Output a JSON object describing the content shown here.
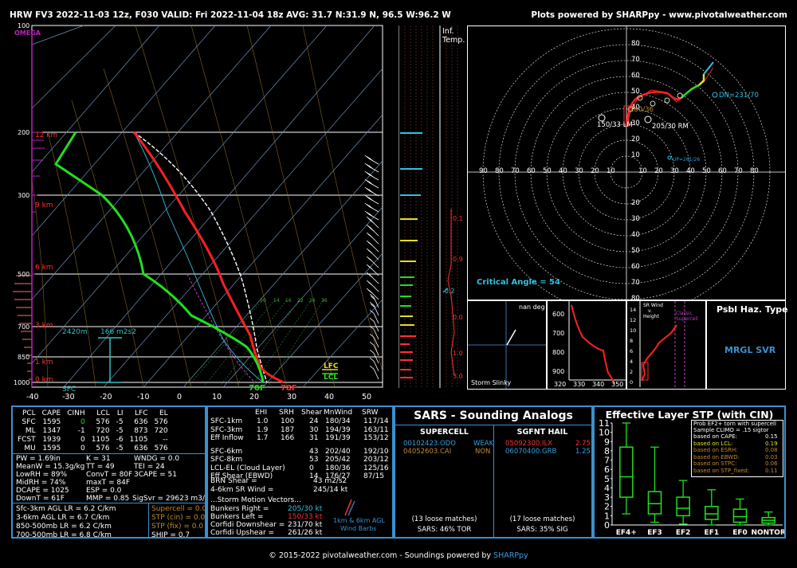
{
  "header": {
    "title": "HRW FV3 2022-11-03 12z, F030  VALID: Fri 2022-11-04 18z  AVG: 31.7 N:31.9 N, 96.5 W:96.2 W",
    "credit": "Plots powered by SHARPpy - www.pivotalweather.com"
  },
  "skewt": {
    "pressure_labels": [
      "100",
      "200",
      "300",
      "500",
      "700",
      "850",
      "1000"
    ],
    "height_labels": [
      "12 km",
      "9 km",
      "6 km",
      "3 km",
      "1 km",
      "0 km"
    ],
    "temp_ticks": [
      "-40",
      "-30",
      "-20",
      "-10",
      "0",
      "10",
      "20",
      "30",
      "40",
      "50"
    ],
    "omega_label": "OMEGA",
    "hgt_label": "2420m",
    "srh_label": "166 m2s2",
    "sfc_label": "SFC",
    "lfc_label": "LFC",
    "lcl_label": "LCL",
    "tsfc_label": "78F",
    "tdsfc_label": "70F",
    "mix_labels": [
      "10",
      "14",
      "16",
      "22",
      "26",
      "36",
      "44"
    ]
  },
  "inftemp": {
    "label1": "Inf.",
    "label2": "Temp.",
    "values": [
      "0.1",
      "0.9",
      "-0.2",
      "0.0",
      "1.0",
      "3.0"
    ]
  },
  "hodograph": {
    "rings": [
      "80",
      "70",
      "60",
      "50",
      "40",
      "30",
      "20",
      "10",
      "20",
      "30",
      "40",
      "50",
      "60",
      "70",
      "80"
    ],
    "x_ticks": [
      "90",
      "80",
      "70",
      "60",
      "50",
      "40",
      "30",
      "20",
      "10",
      "10",
      "20",
      "30",
      "40",
      "50",
      "60",
      "70",
      "80"
    ],
    "lm_label": "150/33 LM",
    "rm_label": "205/30 RM",
    "dn_label": "DN=231/70",
    "mean_label": "180/36",
    "up_label": "UP=261/26",
    "critical": "Critical Angle = 54"
  },
  "slinky": {
    "title": "nan deg",
    "label": "Storm Slinky"
  },
  "thetae": {
    "y_ticks": [
      "600",
      "700",
      "800",
      "900"
    ],
    "x_ticks": [
      "320",
      "330",
      "340",
      "350"
    ]
  },
  "srwind": {
    "title1": "SR Wind",
    "title2": "v.",
    "title3": "Height",
    "ticks": [
      "14",
      "12",
      "10",
      "8",
      "6",
      "4",
      "2",
      "0"
    ],
    "classic": "Classic Supercell"
  },
  "haz": {
    "title": "Psbl Haz. Type",
    "value": "MRGL SVR"
  },
  "parcels": {
    "headers": [
      "PCL",
      "CAPE",
      "CINH",
      "LCL",
      "LI",
      "LFC",
      "EL"
    ],
    "rows": [
      [
        "SFC",
        "1595",
        "0",
        "576",
        "-5",
        "636",
        "576"
      ],
      [
        "ML",
        "1347",
        "-1",
        "720",
        "-5",
        "873",
        "720"
      ],
      [
        "FCST",
        "1939",
        "0",
        "1105",
        "-6",
        "1105",
        "--"
      ],
      [
        "MU",
        "1595",
        "0",
        "576",
        "-5",
        "636",
        "576"
      ]
    ],
    "misc": [
      [
        "PW = 1.69in",
        "K = 31",
        "WNDG = 0.0"
      ],
      [
        "MeanW = 15.3g/kg",
        "TT = 49",
        "TEI = 24"
      ],
      [
        "LowRH = 89%",
        "ConvT = 80F",
        "3CAPE = 51"
      ],
      [
        "MidRH = 74%",
        "maxT = 84F",
        ""
      ],
      [
        "DCAPE = 1025",
        "ESP = 0.0",
        ""
      ],
      [
        "DownT = 61F",
        "MMP = 0.85",
        "SigSvr = 29623 m3/s3"
      ]
    ],
    "lapse": [
      "Sfc-3km AGL LR = 6.2 C/km",
      "3-6km AGL LR = 6.7 C/km",
      "850-500mb LR = 6.2 C/km",
      "700-500mb LR = 6.8 C/km"
    ],
    "sev": [
      "Supercell = 0.0",
      "STP (cin) = 0.0",
      "STP (fix) = 0.0",
      "SHIP = 0.7"
    ]
  },
  "kinematics": {
    "headers": [
      "EHI",
      "SRH",
      "Shear",
      "MnWind",
      "SRW"
    ],
    "rows": [
      [
        "SFC-1km",
        "1.0",
        "100",
        "24",
        "180/34",
        "117/14"
      ],
      [
        "SFC-3km",
        "1.9",
        "187",
        "30",
        "194/39",
        "163/11"
      ],
      [
        "Eff Inflow",
        "1.7",
        "166",
        "31",
        "191/39",
        "153/12"
      ],
      [
        "SFC-6km",
        "",
        "",
        "43",
        "202/40",
        "192/10"
      ],
      [
        "SFC-8km",
        "",
        "",
        "53",
        "205/42",
        "203/12"
      ],
      [
        "LCL-EL (Cloud Layer)",
        "",
        "",
        "0",
        "180/36",
        "125/16"
      ],
      [
        "Eff Shear (EBWD)",
        "",
        "",
        "14",
        "176/27",
        "87/15"
      ]
    ],
    "brn_label": "BRN Shear =",
    "brn_value": "43 m2/s2",
    "sr_label": "4-6km SR Wind =",
    "sr_value": "245/14 kt",
    "storm_title": "...Storm Motion Vectors...",
    "motions": [
      [
        "Bunkers Right =",
        "205/30 kt"
      ],
      [
        "Bunkers Left =",
        "150/33 kt"
      ],
      [
        "Corfidi Downshear =",
        "231/70 kt"
      ],
      [
        "Corfidi Upshear =",
        "261/26 kt"
      ]
    ],
    "barb_label1": "1km & 6km AGL",
    "barb_label2": "Wind Barbs"
  },
  "sars": {
    "title": "SARS - Sounding Analogs",
    "supercell_title": "SUPERCELL",
    "hail_title": "SGFNT HAIL",
    "supercell": [
      [
        "00102423.ODO",
        "WEAK"
      ],
      [
        "04052603.CAI",
        "NON"
      ]
    ],
    "hail": [
      [
        "05092300.ILX",
        "2.75"
      ],
      [
        "06070400.GRB",
        "1.25"
      ]
    ],
    "supercell_matches": "(13 loose matches)",
    "hail_matches": "(17 loose matches)",
    "supercell_result": "SARS: 46% TOR",
    "hail_result": "SARS: 35% SIG"
  },
  "stp": {
    "title": "Effective Layer STP (with CIN)",
    "legend_title1": "Prob EF2+ torn with supercell",
    "legend_title2": "Sample CLIMO = .15 sigtor",
    "legend": [
      [
        "based on CAPE:",
        "0.15"
      ],
      [
        "based on LCL:",
        "0.19"
      ],
      [
        "based on ESRH:",
        "0.08"
      ],
      [
        "based on EBWD:",
        "0.03"
      ],
      [
        "based on STPC:",
        "0.06"
      ],
      [
        "based on STP_fixed:",
        "0.11"
      ]
    ]
  },
  "chart_data": {
    "type": "box",
    "title": "Effective Layer STP (with CIN)",
    "categories": [
      "EF4+",
      "EF3",
      "EF2",
      "EF1",
      "EF0",
      "NONTOR"
    ],
    "ylim": [
      0,
      11
    ],
    "boxes": [
      {
        "min": 1.2,
        "q1": 3.0,
        "median": 5.2,
        "q3": 8.4,
        "max": 11.0
      },
      {
        "min": 0.3,
        "q1": 1.2,
        "median": 2.3,
        "q3": 3.6,
        "max": 8.4
      },
      {
        "min": 0.1,
        "q1": 1.0,
        "median": 1.8,
        "q3": 3.0,
        "max": 4.8
      },
      {
        "min": 0.0,
        "q1": 0.6,
        "median": 1.2,
        "q3": 2.0,
        "max": 3.8
      },
      {
        "min": 0.0,
        "q1": 0.3,
        "median": 0.9,
        "q3": 1.7,
        "max": 2.8
      },
      {
        "min": 0.0,
        "q1": 0.2,
        "median": 0.5,
        "q3": 0.8,
        "max": 1.4
      }
    ],
    "y_ticks": [
      "0",
      "1",
      "2",
      "3",
      "4",
      "5",
      "6",
      "7",
      "8",
      "9",
      "10",
      "11"
    ]
  },
  "footer": {
    "text": "© 2015-2022 pivotalweather.com - Soundings powered by ",
    "link": "SHARPpy"
  },
  "colors": {
    "border": "#3a90d0",
    "temp": "#ff2020",
    "dew": "#20e020",
    "parcel": "#ffffff"
  }
}
